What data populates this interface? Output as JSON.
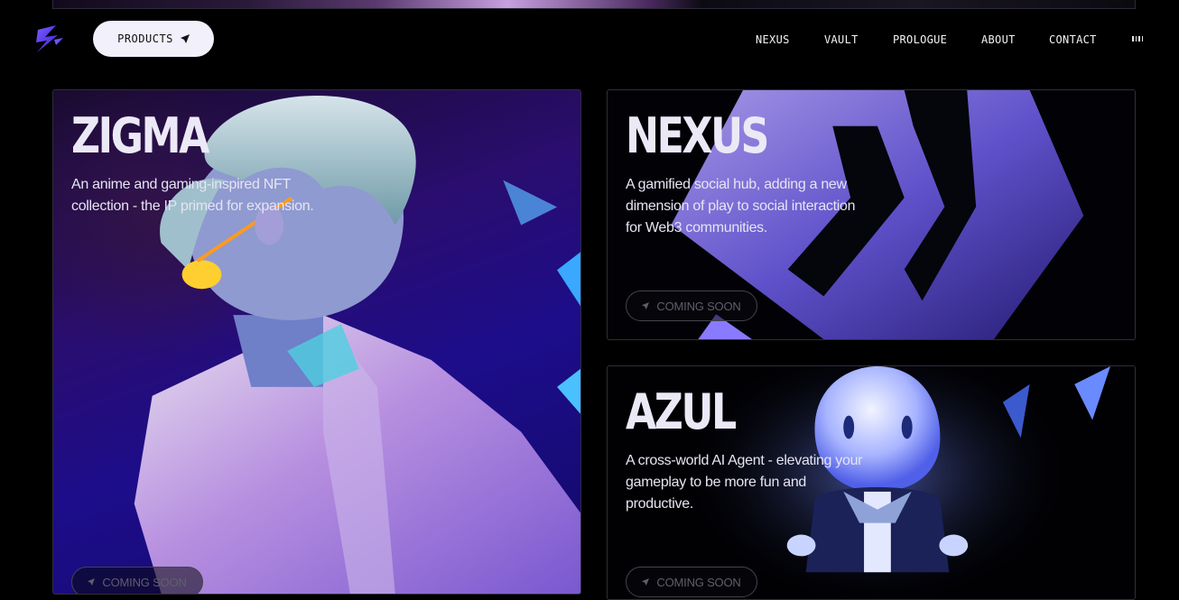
{
  "nav": {
    "products_label": "PRODUCTS",
    "links": [
      {
        "label": "NEXUS"
      },
      {
        "label": "VAULT"
      },
      {
        "label": "PROLOGUE"
      },
      {
        "label": "ABOUT"
      },
      {
        "label": "CONTACT"
      }
    ],
    "menu_icon": "menu-dots-icon",
    "logo_icon": "z-logo-icon"
  },
  "cards": [
    {
      "title": "ZIGMA",
      "description": "An anime and gaming-inspired NFT collection - the IP primed for expansion.",
      "button_label": "COMING SOON",
      "button_icon": "send-arrow-icon"
    },
    {
      "title": "NEXUS",
      "description": "A gamified social hub, adding a new dimension of play to social interaction for Web3 communities.",
      "button_label": "COMING SOON",
      "button_icon": "send-arrow-icon"
    },
    {
      "title": "AZUL",
      "description": "A cross-world AI Agent - elevating your gameplay to be more fun and productive.",
      "button_label": "COMING SOON",
      "button_icon": "send-arrow-icon"
    }
  ],
  "colors": {
    "background": "#000000",
    "accent_purple": "#5a3fe0",
    "button_bg": "#f1f0fb",
    "text": "#ece9f7",
    "muted_button_text": "#5f5f6b"
  }
}
